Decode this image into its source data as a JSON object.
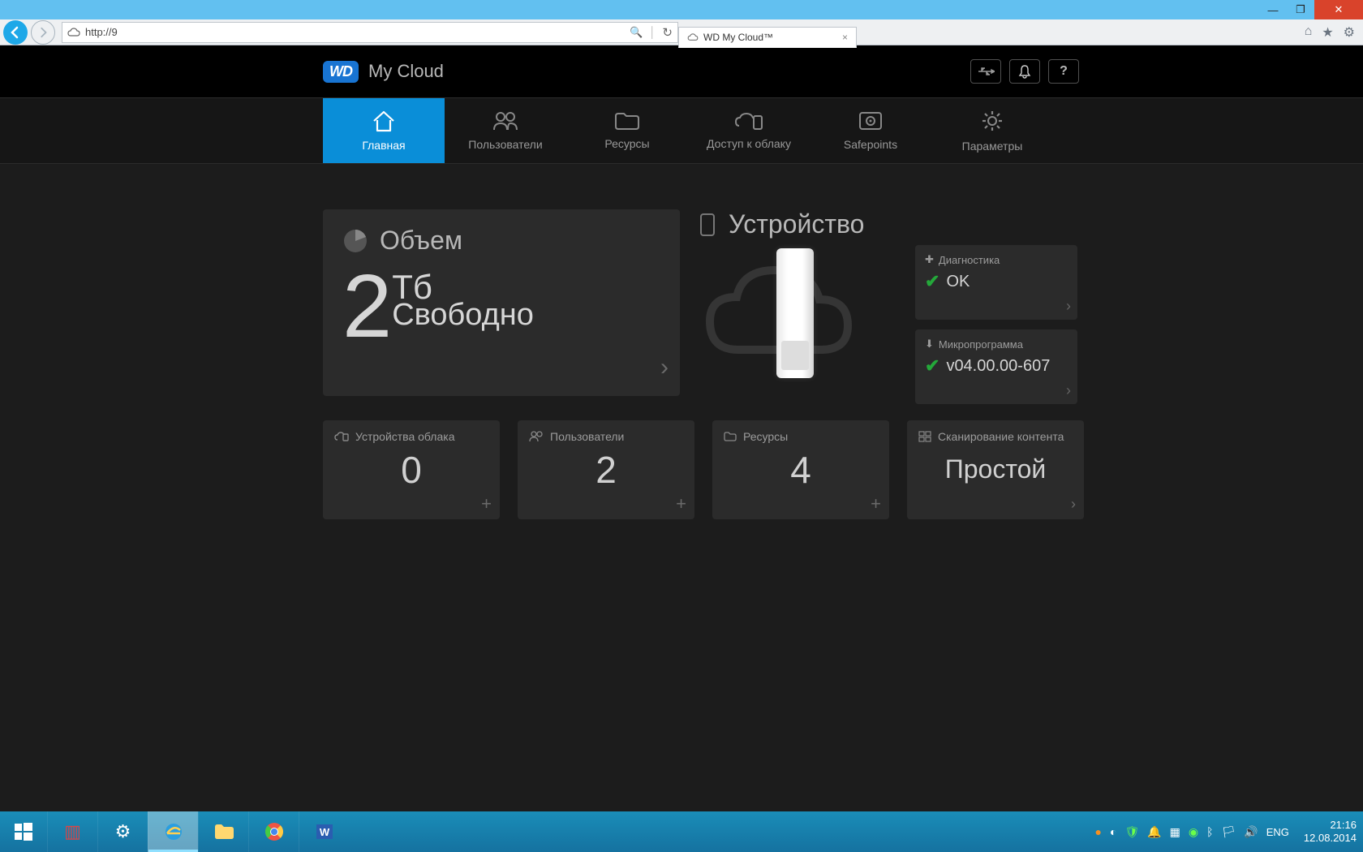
{
  "window": {
    "minimize": "—",
    "maximize": "❐",
    "close": "✕"
  },
  "browser": {
    "url": "http://9",
    "search_icon": "🔍",
    "refresh_icon": "↻",
    "tab_title": "WD My Cloud™",
    "tab_close": "×",
    "home_icon": "⌂",
    "fav_icon": "★",
    "gear_icon": "⚙"
  },
  "header": {
    "logo": "WD",
    "product": "My Cloud",
    "usb_icon": "⟟",
    "bell_icon": "🔔",
    "help_icon": "?"
  },
  "nav": {
    "items": [
      {
        "label": "Главная",
        "active": true
      },
      {
        "label": "Пользователи",
        "active": false
      },
      {
        "label": "Ресурсы",
        "active": false
      },
      {
        "label": "Доступ к облаку",
        "active": false
      },
      {
        "label": "Safepoints",
        "active": false
      },
      {
        "label": "Параметры",
        "active": false
      }
    ]
  },
  "capacity": {
    "title": "Объем",
    "value": "2",
    "unit": "Тб",
    "free": "Свободно"
  },
  "device": {
    "title": "Устройство",
    "diag_label": "Диагностика",
    "diag_value": "OK",
    "fw_label": "Микропрограмма",
    "fw_value": "v04.00.00-607"
  },
  "stats": {
    "cloud_devices": {
      "label": "Устройства облака",
      "value": "0"
    },
    "users": {
      "label": "Пользователи",
      "value": "2"
    },
    "shares": {
      "label": "Ресурсы",
      "value": "4"
    },
    "scan": {
      "label": "Сканирование контента",
      "value": "Простой"
    }
  },
  "taskbar": {
    "lang": "ENG",
    "time": "21:16",
    "date": "12.08.2014"
  }
}
